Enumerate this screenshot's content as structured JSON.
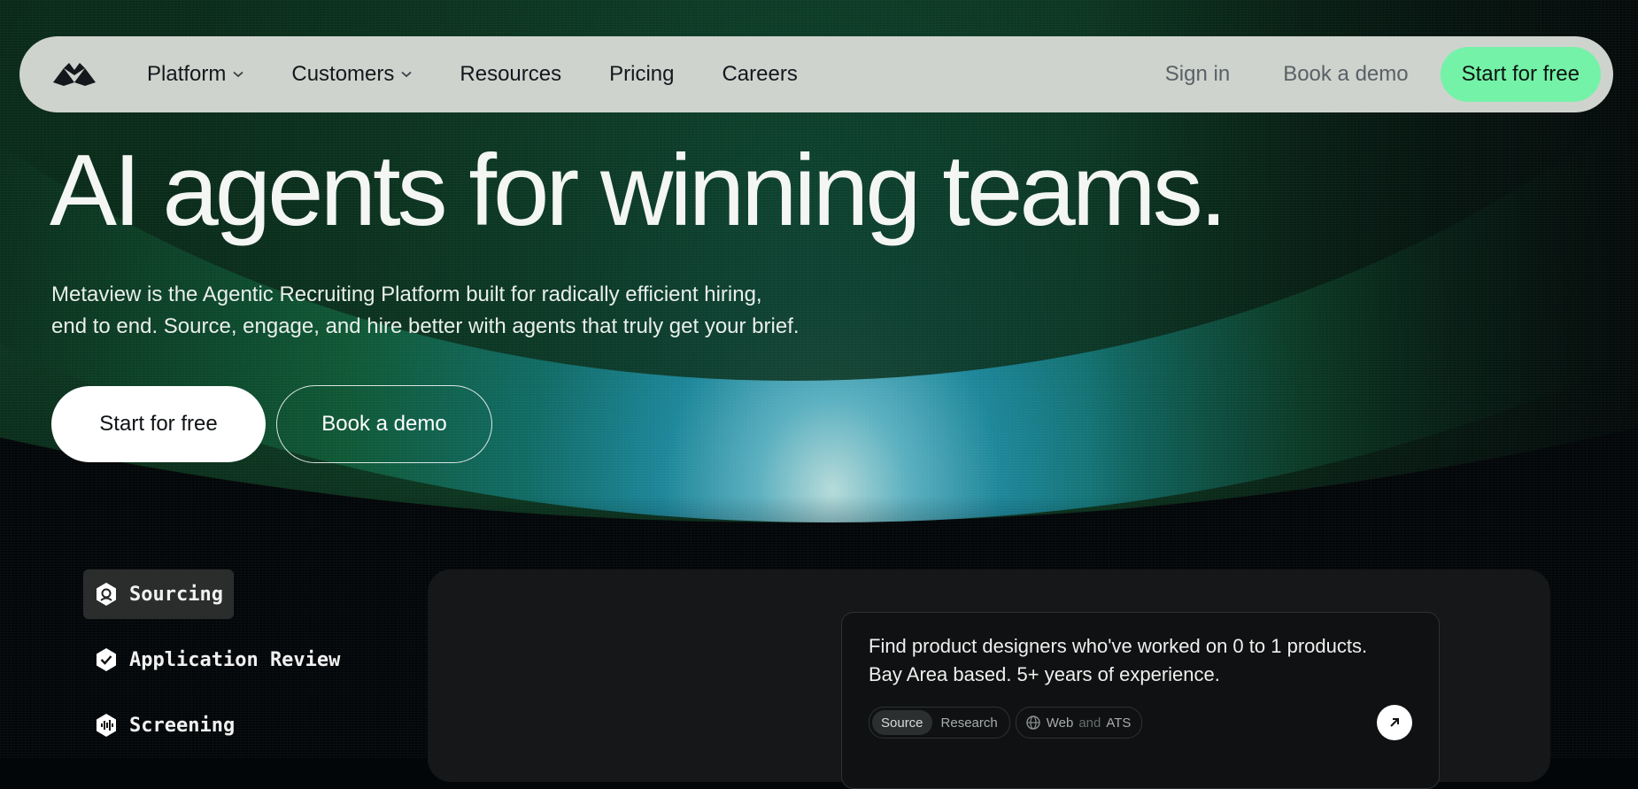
{
  "colors": {
    "nav_background": "#cfd3ce",
    "cta_green": "#74f2a8",
    "page_background": "#030608",
    "panel_background": "#151718"
  },
  "nav": {
    "logo": "metaview-logo-icon",
    "links": [
      {
        "label": "Platform",
        "has_dropdown": true
      },
      {
        "label": "Customers",
        "has_dropdown": true
      },
      {
        "label": "Resources",
        "has_dropdown": false
      },
      {
        "label": "Pricing",
        "has_dropdown": false
      },
      {
        "label": "Careers",
        "has_dropdown": false
      }
    ],
    "sign_in": "Sign in",
    "book_demo": "Book a demo",
    "cta": "Start for free"
  },
  "hero": {
    "title": "AI agents for winning teams.",
    "subtitle_line1": "Metaview is the Agentic Recruiting Platform built for radically efficient hiring,",
    "subtitle_line2": "end to end. Source, engage, and hire better with agents that truly get your brief.",
    "primary_button": "Start for free",
    "secondary_button": "Book a demo"
  },
  "tabs": [
    {
      "label": "Sourcing",
      "icon": "sourcing-icon",
      "active": true
    },
    {
      "label": "Application Review",
      "icon": "check-badge-icon",
      "active": false
    },
    {
      "label": "Screening",
      "icon": "audio-wave-icon",
      "active": false
    }
  ],
  "prompt": {
    "line1": "Find product designers who've worked on 0 to 1 products.",
    "line2": "Bay Area based. 5+ years of experience.",
    "modes": [
      "Source",
      "Research"
    ],
    "active_mode": "Source",
    "scope_first": "Web",
    "scope_joiner": "and",
    "scope_second": "ATS",
    "scope_icon": "globe-icon",
    "send_icon": "arrow-up-right-icon"
  }
}
